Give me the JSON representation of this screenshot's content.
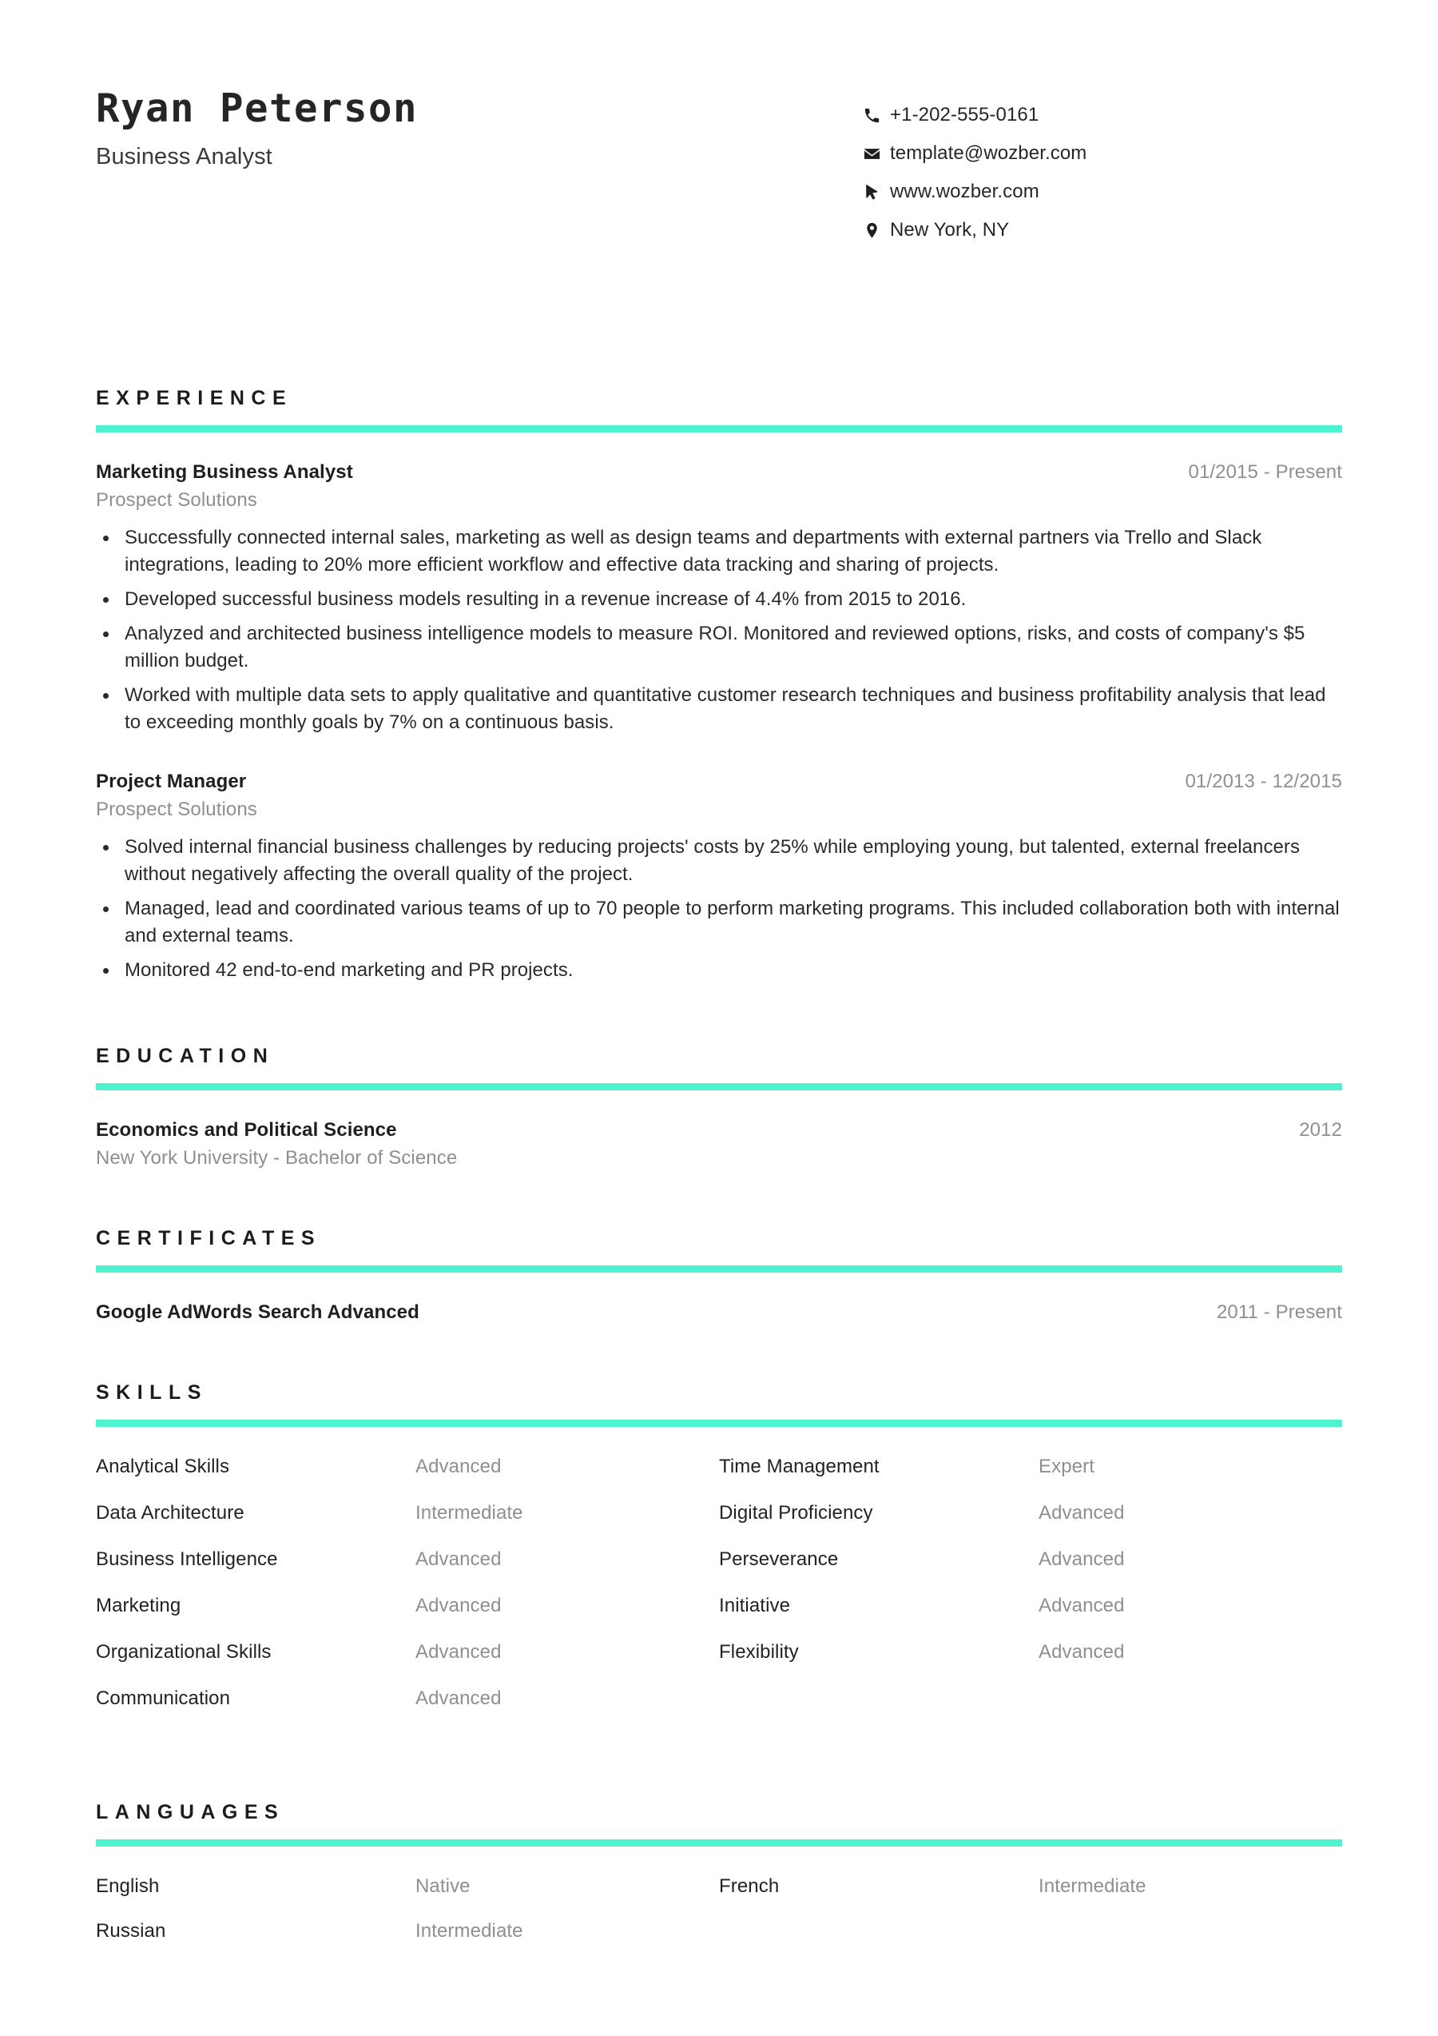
{
  "accent_color": "#4df2ce",
  "header": {
    "full_name": "Ryan Peterson",
    "job_role": "Business Analyst",
    "contacts": [
      {
        "icon": "phone-icon",
        "text": "+1-202-555-0161"
      },
      {
        "icon": "envelope-icon",
        "text": "template@wozber.com"
      },
      {
        "icon": "cursor-icon",
        "text": "www.wozber.com"
      },
      {
        "icon": "location-pin-icon",
        "text": "New York, NY"
      }
    ]
  },
  "sections": {
    "experience": {
      "title": "EXPERIENCE",
      "entries": [
        {
          "title": "Marketing Business Analyst",
          "date": "01/2015 - Present",
          "subtitle": "Prospect Solutions",
          "bullets": [
            "Successfully connected internal sales, marketing as well as design teams and departments with external partners via Trello and Slack integrations, leading to 20% more efficient workflow and effective data tracking and sharing of projects.",
            "Developed successful business models resulting in a revenue increase of 4.4% from 2015 to 2016.",
            "Analyzed and architected business intelligence models to measure ROI. Monitored and reviewed options, risks, and costs of company's $5 million budget.",
            "Worked with multiple data sets to apply qualitative and quantitative customer research techniques and business profitability analysis that lead to exceeding monthly goals by 7% on a continuous basis."
          ]
        },
        {
          "title": "Project Manager",
          "date": "01/2013 - 12/2015",
          "subtitle": "Prospect Solutions",
          "bullets": [
            "Solved internal financial business challenges by reducing projects' costs by 25% while employing young, but talented, external freelancers without negatively affecting the overall quality of the project.",
            "Managed, lead and coordinated various teams of up to 70 people to perform marketing programs. This included collaboration both with internal and external teams.",
            "Monitored 42 end-to-end marketing and PR projects."
          ]
        }
      ]
    },
    "education": {
      "title": "EDUCATION",
      "entries": [
        {
          "title": "Economics and Political Science",
          "date": "2012",
          "subtitle": "New York University - Bachelor of Science"
        }
      ]
    },
    "certificates": {
      "title": "CERTIFICATES",
      "entries": [
        {
          "title": "Google AdWords Search Advanced",
          "date": "2011 - Present"
        }
      ]
    },
    "skills": {
      "title": "SKILLS",
      "left_column": [
        {
          "name": "Analytical Skills",
          "level": "Advanced"
        },
        {
          "name": "Data Architecture",
          "level": "Intermediate"
        },
        {
          "name": "Business Intelligence",
          "level": "Advanced"
        },
        {
          "name": "Marketing",
          "level": "Advanced"
        },
        {
          "name": "Organizational Skills",
          "level": "Advanced"
        },
        {
          "name": "Communication",
          "level": "Advanced"
        }
      ],
      "right_column": [
        {
          "name": "Time Management",
          "level": "Expert"
        },
        {
          "name": "Digital Proficiency",
          "level": "Advanced"
        },
        {
          "name": "Perseverance",
          "level": "Advanced"
        },
        {
          "name": "Initiative",
          "level": "Advanced"
        },
        {
          "name": "Flexibility",
          "level": "Advanced"
        }
      ]
    },
    "languages": {
      "title": "LANGUAGES",
      "left_column": [
        {
          "name": "English",
          "level": "Native"
        },
        {
          "name": "Russian",
          "level": "Intermediate"
        }
      ],
      "right_column": [
        {
          "name": "French",
          "level": "Intermediate"
        }
      ]
    }
  }
}
